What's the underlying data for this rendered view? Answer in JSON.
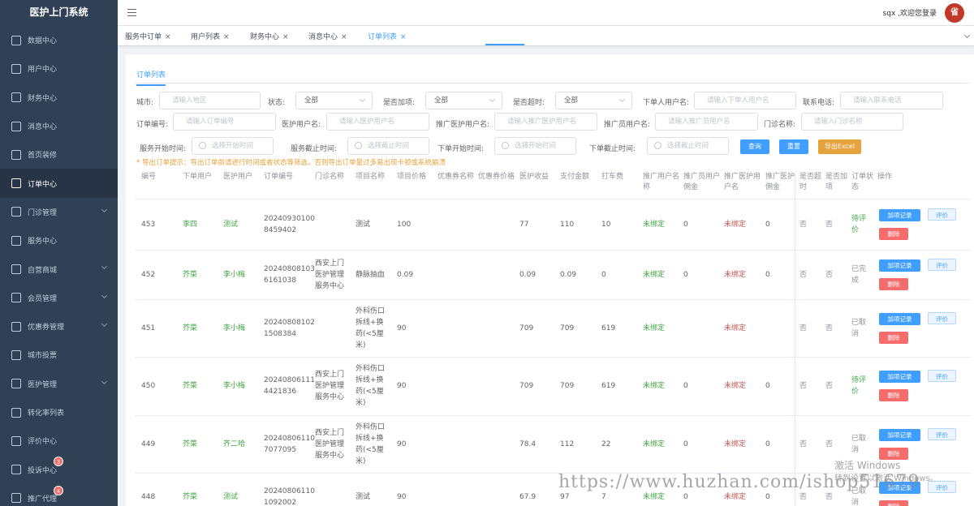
{
  "app": {
    "title": "医护上门系统",
    "welcome": "sqx ,欢迎您登录",
    "avatar_text": "省"
  },
  "sidebar": {
    "items": [
      {
        "label": "数据中心",
        "icon": "monitor-icon",
        "expand": false
      },
      {
        "label": "用户中心",
        "icon": "user-icon",
        "expand": false
      },
      {
        "label": "财务中心",
        "icon": "wallet-icon",
        "expand": false
      },
      {
        "label": "消息中心",
        "icon": "message-icon",
        "expand": false
      },
      {
        "label": "首页装修",
        "icon": "box-icon",
        "expand": false
      },
      {
        "label": "订单中心",
        "icon": "document-icon",
        "expand": false,
        "active": true
      },
      {
        "label": "门诊管理",
        "icon": "location-icon",
        "expand": true
      },
      {
        "label": "服务中心",
        "icon": "clipboard-icon",
        "expand": false
      },
      {
        "label": "自营商城",
        "icon": "bag-icon",
        "expand": true
      },
      {
        "label": "会员管理",
        "icon": "member-icon",
        "expand": true
      },
      {
        "label": "优惠券管理",
        "icon": "coupon-icon",
        "expand": true
      },
      {
        "label": "城市投票",
        "icon": "vote-icon",
        "expand": false
      },
      {
        "label": "医护管理",
        "icon": "nurse-icon",
        "expand": true
      },
      {
        "label": "转化率列表",
        "icon": "refresh-icon",
        "expand": false
      },
      {
        "label": "评价中心",
        "icon": "comment-icon",
        "expand": false
      },
      {
        "label": "投诉中心",
        "icon": "complaint-icon",
        "expand": false,
        "badge": "3"
      },
      {
        "label": "推广代理",
        "icon": "share-icon",
        "expand": false,
        "badge": "4"
      }
    ]
  },
  "tags": [
    {
      "label": "服务中订单",
      "close": "×"
    },
    {
      "label": "用户列表",
      "close": "×"
    },
    {
      "label": "财务中心",
      "close": "×"
    },
    {
      "label": "消息中心",
      "close": "×"
    },
    {
      "label": "订单列表",
      "close": "×",
      "active": true
    }
  ],
  "subtab": "订单列表",
  "filters": {
    "city": {
      "label": "城市:",
      "placeholder": "请输入地区"
    },
    "status": {
      "label": "状态:",
      "value": "全部"
    },
    "extra": {
      "label": "是否加项:",
      "value": "全部"
    },
    "overtime": {
      "label": "是否超时:",
      "value": "全部"
    },
    "user_name": {
      "label": "下单人用户名:",
      "placeholder": "请输入下单人用户名"
    },
    "phone": {
      "label": "联系电话:",
      "placeholder": "请输入联系电话"
    },
    "order_no": {
      "label": "订单编号:",
      "placeholder": "请输入订单编号"
    },
    "nurse_name": {
      "label": "医护用户名:",
      "placeholder": "请输入医护用户名"
    },
    "promo_nurse": {
      "label": "推广医护用户名:",
      "placeholder": "请输入推广医护用户名"
    },
    "promoter": {
      "label": "推广员用户名:",
      "placeholder": "请输入推广员用户名"
    },
    "clinic": {
      "label": "门诊名称:",
      "placeholder": "请输入门诊名称"
    },
    "service_start": {
      "label": "服务开始时间:",
      "placeholder": "选择开始时间"
    },
    "service_end": {
      "label": "服务截止时间:",
      "placeholder": "选择截止时间"
    },
    "order_start": {
      "label": "下单开始时间:",
      "placeholder": "选择开始时间"
    },
    "order_end": {
      "label": "下单截止时间:",
      "placeholder": "选择截止时间"
    },
    "query_btn": "查询",
    "reset_btn": "重置",
    "export_btn": "导出Excel"
  },
  "tip": "* 导出订单提示：导出订单前请进行时间或者状态等筛选，否则导出订单量过多易出现卡顿或系统崩溃",
  "table": {
    "headers": [
      "编号",
      "下单用户",
      "医护用户",
      "订单编号",
      "门诊名称",
      "项目名称",
      "项目价格",
      "优惠券名称",
      "优惠券价格",
      "医护收益",
      "支付金额",
      "打车费",
      "推广用户名称",
      "推广员用户佣金",
      "推广医护用户名",
      "推广医护佣金",
      "是否超时",
      "是否加项",
      "订单状态",
      "操作"
    ],
    "action_labels": {
      "record": "加项记录",
      "eval": "评价",
      "delete": "删除"
    },
    "rows": [
      {
        "id": "453",
        "user": "李四",
        "nurse": "测试",
        "order_no": [
          "20240930100",
          "8459402"
        ],
        "clinic": [],
        "project": [
          "测试"
        ],
        "price": "100",
        "coupon": "",
        "coupon_price": "",
        "income": "77",
        "paid": "110",
        "taxi": "10",
        "promo_user": "未绑定",
        "promo_fee": "0",
        "promo_nurse": "未绑定",
        "promo_nurse_fee": "0",
        "overtime": "否",
        "extra": "否",
        "status": [
          "待评",
          "价"
        ],
        "status_color": "green"
      },
      {
        "id": "452",
        "user": "芥菜",
        "nurse": "李小梅",
        "order_no": [
          "20240808103",
          "6161038"
        ],
        "clinic": [
          "西安上门",
          "医护管理",
          "服务中心"
        ],
        "project": [
          "静脉抽血"
        ],
        "price": "0.09",
        "coupon": "",
        "coupon_price": "",
        "income": "0.09",
        "paid": "0.09",
        "taxi": "0",
        "promo_user": "未绑定",
        "promo_fee": "0",
        "promo_nurse": "未绑定",
        "promo_nurse_fee": "0",
        "overtime": "否",
        "extra": "否",
        "status": [
          "已完",
          "成"
        ],
        "status_color": "gray"
      },
      {
        "id": "451",
        "user": "芥菜",
        "nurse": "李小梅",
        "order_no": [
          "20240808102",
          "1508384"
        ],
        "clinic": [],
        "project": [
          "外科伤口",
          "拆线+换",
          "药(<5厘",
          "米)"
        ],
        "price": "90",
        "coupon": "",
        "coupon_price": "",
        "income": "709",
        "paid": "709",
        "taxi": "619",
        "promo_user": "未绑定",
        "promo_fee": "",
        "promo_nurse": "未绑定",
        "promo_nurse_fee": "",
        "overtime": "否",
        "extra": "否",
        "status": [
          "已取",
          "消"
        ],
        "status_color": "gray"
      },
      {
        "id": "450",
        "user": "芥菜",
        "nurse": "李小梅",
        "order_no": [
          "20240806111",
          "4421836"
        ],
        "clinic": [
          "西安上门",
          "医护管理",
          "服务中心"
        ],
        "project": [
          "外科伤口",
          "拆线+换",
          "药(<5厘",
          "米)"
        ],
        "price": "90",
        "coupon": "",
        "coupon_price": "",
        "income": "709",
        "paid": "709",
        "taxi": "619",
        "promo_user": "未绑定",
        "promo_fee": "0",
        "promo_nurse": "未绑定",
        "promo_nurse_fee": "0",
        "overtime": "否",
        "extra": "否",
        "status": [
          "待评",
          "价"
        ],
        "status_color": "green"
      },
      {
        "id": "449",
        "user": "芥菜",
        "nurse": "齐二哈",
        "order_no": [
          "20240806110",
          "7077095"
        ],
        "clinic": [
          "西安上门",
          "医护管理",
          "服务中心"
        ],
        "project": [
          "外科伤口",
          "拆线+换",
          "药(<5厘",
          "米)"
        ],
        "price": "90",
        "coupon": "",
        "coupon_price": "",
        "income": "78.4",
        "paid": "112",
        "taxi": "22",
        "promo_user": "未绑定",
        "promo_fee": "0",
        "promo_nurse": "未绑定",
        "promo_nurse_fee": "0",
        "overtime": "否",
        "extra": "否",
        "status": [
          "已取",
          "消"
        ],
        "status_color": "gray"
      },
      {
        "id": "448",
        "user": "芥菜",
        "nurse": "测试",
        "order_no": [
          "20240806110",
          "1092002"
        ],
        "clinic": [],
        "project": [
          "测试"
        ],
        "price": "90",
        "coupon": "",
        "coupon_price": "",
        "income": "67.9",
        "paid": "97",
        "taxi": "7",
        "promo_user": "未绑定",
        "promo_fee": "0",
        "promo_nurse": "未绑定",
        "promo_nurse_fee": "0",
        "overtime": "否",
        "extra": "否",
        "status": [
          "已取",
          "消"
        ],
        "status_color": "gray"
      }
    ]
  },
  "watermark": {
    "activate": "激活 Windows",
    "activate_sub": "转到设置以激活 Windows。",
    "site": "https://www.huzhan.com/ishop51679"
  }
}
